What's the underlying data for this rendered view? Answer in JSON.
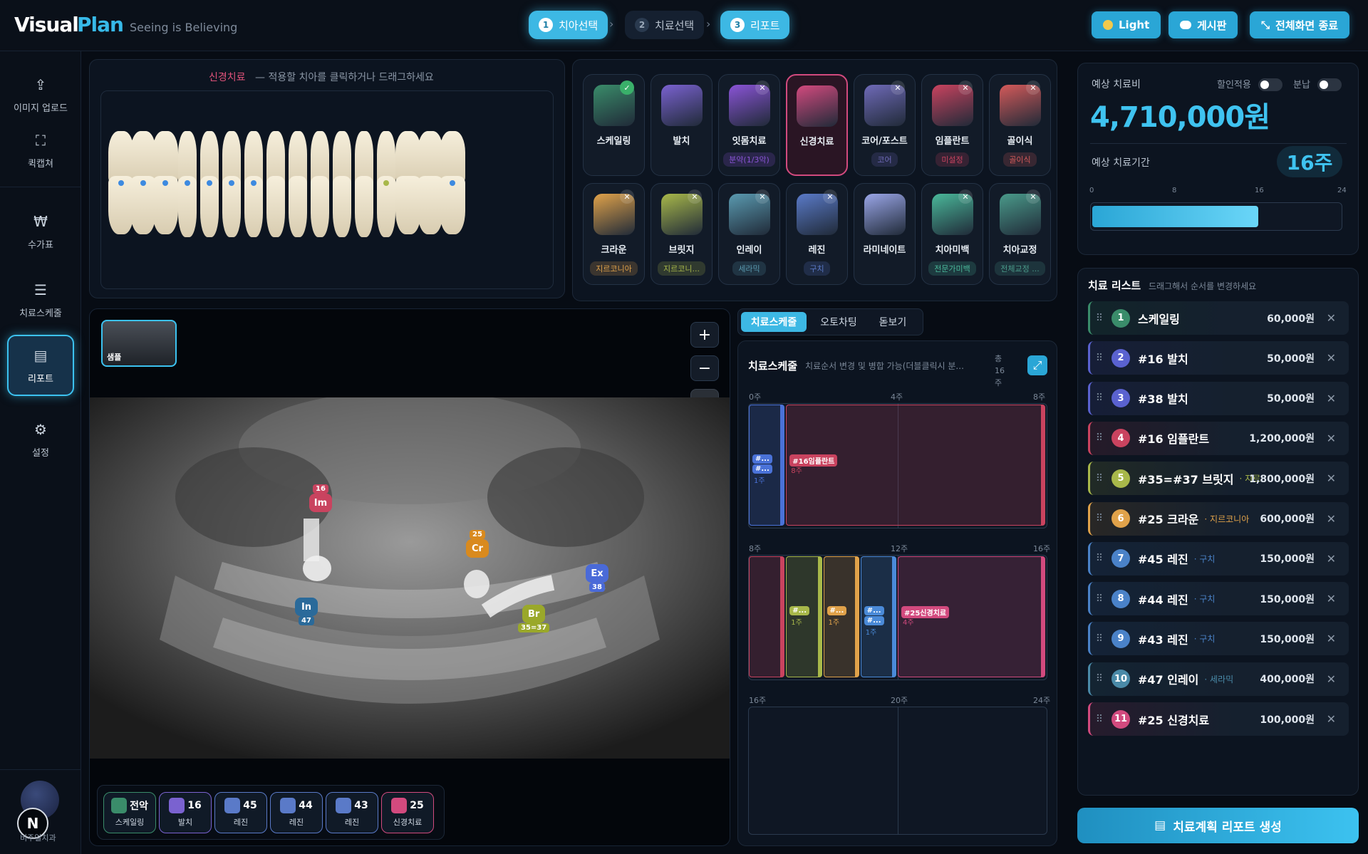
{
  "header": {
    "logo_visual": "Visual",
    "logo_plan": "Plan",
    "tagline": "Seeing is Believing",
    "steps": [
      {
        "num": "1",
        "label": "치아선택"
      },
      {
        "num": "2",
        "label": "치료선택"
      },
      {
        "num": "3",
        "label": "리포트"
      }
    ],
    "light_label": "Light",
    "board_label": "게시판",
    "exit_fullscreen_label": "전체화면 종료"
  },
  "sidebar": {
    "items": [
      {
        "label": "이미지 업로드",
        "icon": "upload-icon"
      },
      {
        "label": "퀵캡쳐",
        "icon": "capture-icon"
      },
      {
        "label": "수가표",
        "icon": "won-icon"
      },
      {
        "label": "치료스케줄",
        "icon": "schedule-chart-icon"
      },
      {
        "label": "리포트",
        "icon": "report-icon"
      },
      {
        "label": "설정",
        "icon": "gear-icon"
      }
    ],
    "user_initial": "N",
    "clinic_name": "비주얼치과"
  },
  "tooth_chart": {
    "mode": "신경치료",
    "instruction": "— 적용할 치아를 클릭하거나 드래그하세요"
  },
  "treatments": [
    {
      "label": "스케일링",
      "sub": "",
      "color": "#3a8c6a",
      "check": "done"
    },
    {
      "label": "발치",
      "sub": "",
      "color": "#7a62d0",
      "check": ""
    },
    {
      "label": "잇몸치료",
      "sub": "분약(1/3악)",
      "color": "#8a54d6",
      "check": "x"
    },
    {
      "label": "신경치료",
      "sub": "",
      "color": "#d24a7e",
      "check": ""
    },
    {
      "label": "코어/포스트",
      "sub": "코어",
      "color": "#6f6ab8",
      "check": "x"
    },
    {
      "label": "임플란트",
      "sub": "미설정",
      "color": "#c9435f",
      "check": "x"
    },
    {
      "label": "골이식",
      "sub": "골이식",
      "color": "#d45a5a",
      "check": "x"
    },
    {
      "label": "크라운",
      "sub": "지르코니아",
      "color": "#e0a24a",
      "check": "x"
    },
    {
      "label": "브릿지",
      "sub": "지르코니...",
      "color": "#a8b84a",
      "check": "x"
    },
    {
      "label": "인레이",
      "sub": "세라믹",
      "color": "#5a9ab0",
      "check": "x"
    },
    {
      "label": "레진",
      "sub": "구치",
      "color": "#5a7ac8",
      "check": "x"
    },
    {
      "label": "라미네이트",
      "sub": "",
      "color": "#9aa6e8",
      "check": ""
    },
    {
      "label": "치아미백",
      "sub": "전문가미백",
      "color": "#4ab89a",
      "check": "x"
    },
    {
      "label": "치아교정",
      "sub": "전체교정 ...",
      "color": "#4a9a8a",
      "check": "x"
    }
  ],
  "xray": {
    "thumb_label": "샘플",
    "zoom_in": "+",
    "zoom_out": "−",
    "markers": [
      {
        "code": "Im",
        "tooth": "16",
        "color": "#c9435f"
      },
      {
        "code": "Cr",
        "tooth": "25",
        "color": "#d98a1e"
      },
      {
        "code": "Ex",
        "tooth": "38",
        "color": "#4a6ad8"
      },
      {
        "code": "In",
        "tooth": "47",
        "color": "#2a6a9a"
      },
      {
        "code": "Br",
        "tooth": "35=37",
        "color": "#9aa82a"
      }
    ],
    "chips": [
      {
        "code": "전악",
        "label": "스케일링",
        "color": "#3a8c6a"
      },
      {
        "code": "16",
        "label": "발치",
        "color": "#7a62d0"
      },
      {
        "code": "45",
        "label": "레진",
        "color": "#5a7ac8"
      },
      {
        "code": "44",
        "label": "레진",
        "color": "#5a7ac8"
      },
      {
        "code": "43",
        "label": "레진",
        "color": "#5a7ac8"
      },
      {
        "code": "25",
        "label": "신경치료",
        "color": "#d24a7e"
      }
    ]
  },
  "schedule": {
    "tabs": [
      "치료스케줄",
      "오토차팅",
      "돋보기"
    ],
    "title": "치료스케줄",
    "desc": "치료순서 변경 및 병합 가능(더블클릭시 분...",
    "total": "총 16 주",
    "lanes": [
      {
        "start": "0주",
        "mid": "4주",
        "end": "8주"
      },
      {
        "start": "8주",
        "mid": "12주",
        "end": "16주"
      },
      {
        "start": "16주",
        "mid": "20주",
        "end": "24주"
      }
    ],
    "bars": [
      {
        "lane": 0,
        "startWeek": 0,
        "weeks": 1,
        "label": "#...",
        "extra": "#...",
        "dur": "1주",
        "color": "#4a72d8"
      },
      {
        "lane": 0,
        "startWeek": 1,
        "weeks": 7,
        "label": "#16임플란트",
        "dur": "8주",
        "color": "#c9435f"
      },
      {
        "lane": 1,
        "startWeek": 8,
        "weeks": 1,
        "label": "",
        "dur": "",
        "color": "#c9435f"
      },
      {
        "lane": 1,
        "startWeek": 9,
        "weeks": 1,
        "label": "#...",
        "dur": "1주",
        "color": "#a8b84a"
      },
      {
        "lane": 1,
        "startWeek": 10,
        "weeks": 1,
        "label": "#...",
        "dur": "1주",
        "color": "#e0a24a"
      },
      {
        "lane": 1,
        "startWeek": 11,
        "weeks": 1,
        "label": "#...",
        "extra": "#...",
        "dur": "1주",
        "color": "#4a8ad8"
      },
      {
        "lane": 1,
        "startWeek": 12,
        "weeks": 4,
        "label": "#25신경치료",
        "dur": "4주",
        "color": "#d24a7e"
      }
    ]
  },
  "cost": {
    "title": "예상 치료비",
    "discount_label": "할인적용",
    "installment_label": "분납",
    "amount": "4,710,000원",
    "period_label": "예상 치료기간",
    "period": "16주",
    "scale": [
      "0",
      "8",
      "16",
      "24"
    ],
    "progress_weeks": 16,
    "max_weeks": 24
  },
  "treatment_list": {
    "title": "치료 리스트",
    "hint": "드래그해서 순서를 변경하세요",
    "items": [
      {
        "num": "1",
        "name": "스케일링",
        "note": "",
        "price": "60,000원",
        "color": "#3a8c6a"
      },
      {
        "num": "2",
        "name": "#16 발치",
        "note": "",
        "price": "50,000원",
        "color": "#5a62d0"
      },
      {
        "num": "3",
        "name": "#38 발치",
        "note": "",
        "price": "50,000원",
        "color": "#5a62d0"
      },
      {
        "num": "4",
        "name": "#16 임플란트",
        "note": "",
        "price": "1,200,000원",
        "color": "#c9435f"
      },
      {
        "num": "5",
        "name": "#35=#37 브릿지",
        "note": "· 지르",
        "price": "1,800,000원",
        "color": "#a8b84a"
      },
      {
        "num": "6",
        "name": "#25 크라운",
        "note": "· 지르코니아",
        "price": "600,000원",
        "color": "#e0a24a"
      },
      {
        "num": "7",
        "name": "#45 레진",
        "note": "· 구치",
        "price": "150,000원",
        "color": "#4a82c8"
      },
      {
        "num": "8",
        "name": "#44 레진",
        "note": "· 구치",
        "price": "150,000원",
        "color": "#4a82c8"
      },
      {
        "num": "9",
        "name": "#43 레진",
        "note": "· 구치",
        "price": "150,000원",
        "color": "#4a82c8"
      },
      {
        "num": "10",
        "name": "#47 인레이",
        "note": "· 세라믹",
        "price": "400,000원",
        "color": "#4a8aa8"
      },
      {
        "num": "11",
        "name": "#25 신경치료",
        "note": "",
        "price": "100,000원",
        "color": "#d24a7e"
      }
    ]
  },
  "report_button": "치료계획 리포트 생성"
}
